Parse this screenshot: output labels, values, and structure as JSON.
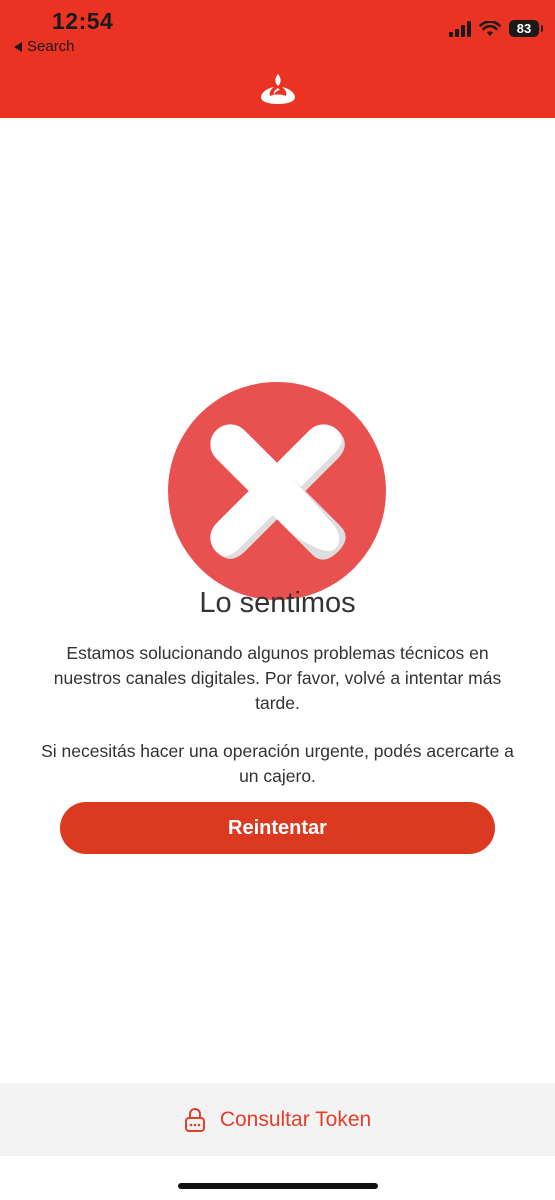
{
  "status_bar": {
    "time": "12:54",
    "back_label": "Search",
    "battery": "83"
  },
  "header": {
    "logo_icon": "santander-flame-icon",
    "background_color": "#ea3323"
  },
  "error": {
    "icon": "error-x-circle-icon",
    "icon_color": "#e95150",
    "title": "Lo sentimos",
    "message_1": "Estamos solucionando algunos problemas técnicos en nuestros canales digitales. Por favor, volvé a intentar más tarde.",
    "message_2": "Si necesitás hacer una operación urgente, podés acercarte a un cajero."
  },
  "actions": {
    "retry_label": "Reintentar",
    "retry_color": "#dc3a20"
  },
  "bottom_bar": {
    "icon": "lock-token-icon",
    "label": "Consultar Token",
    "label_color": "#e33f2a"
  }
}
